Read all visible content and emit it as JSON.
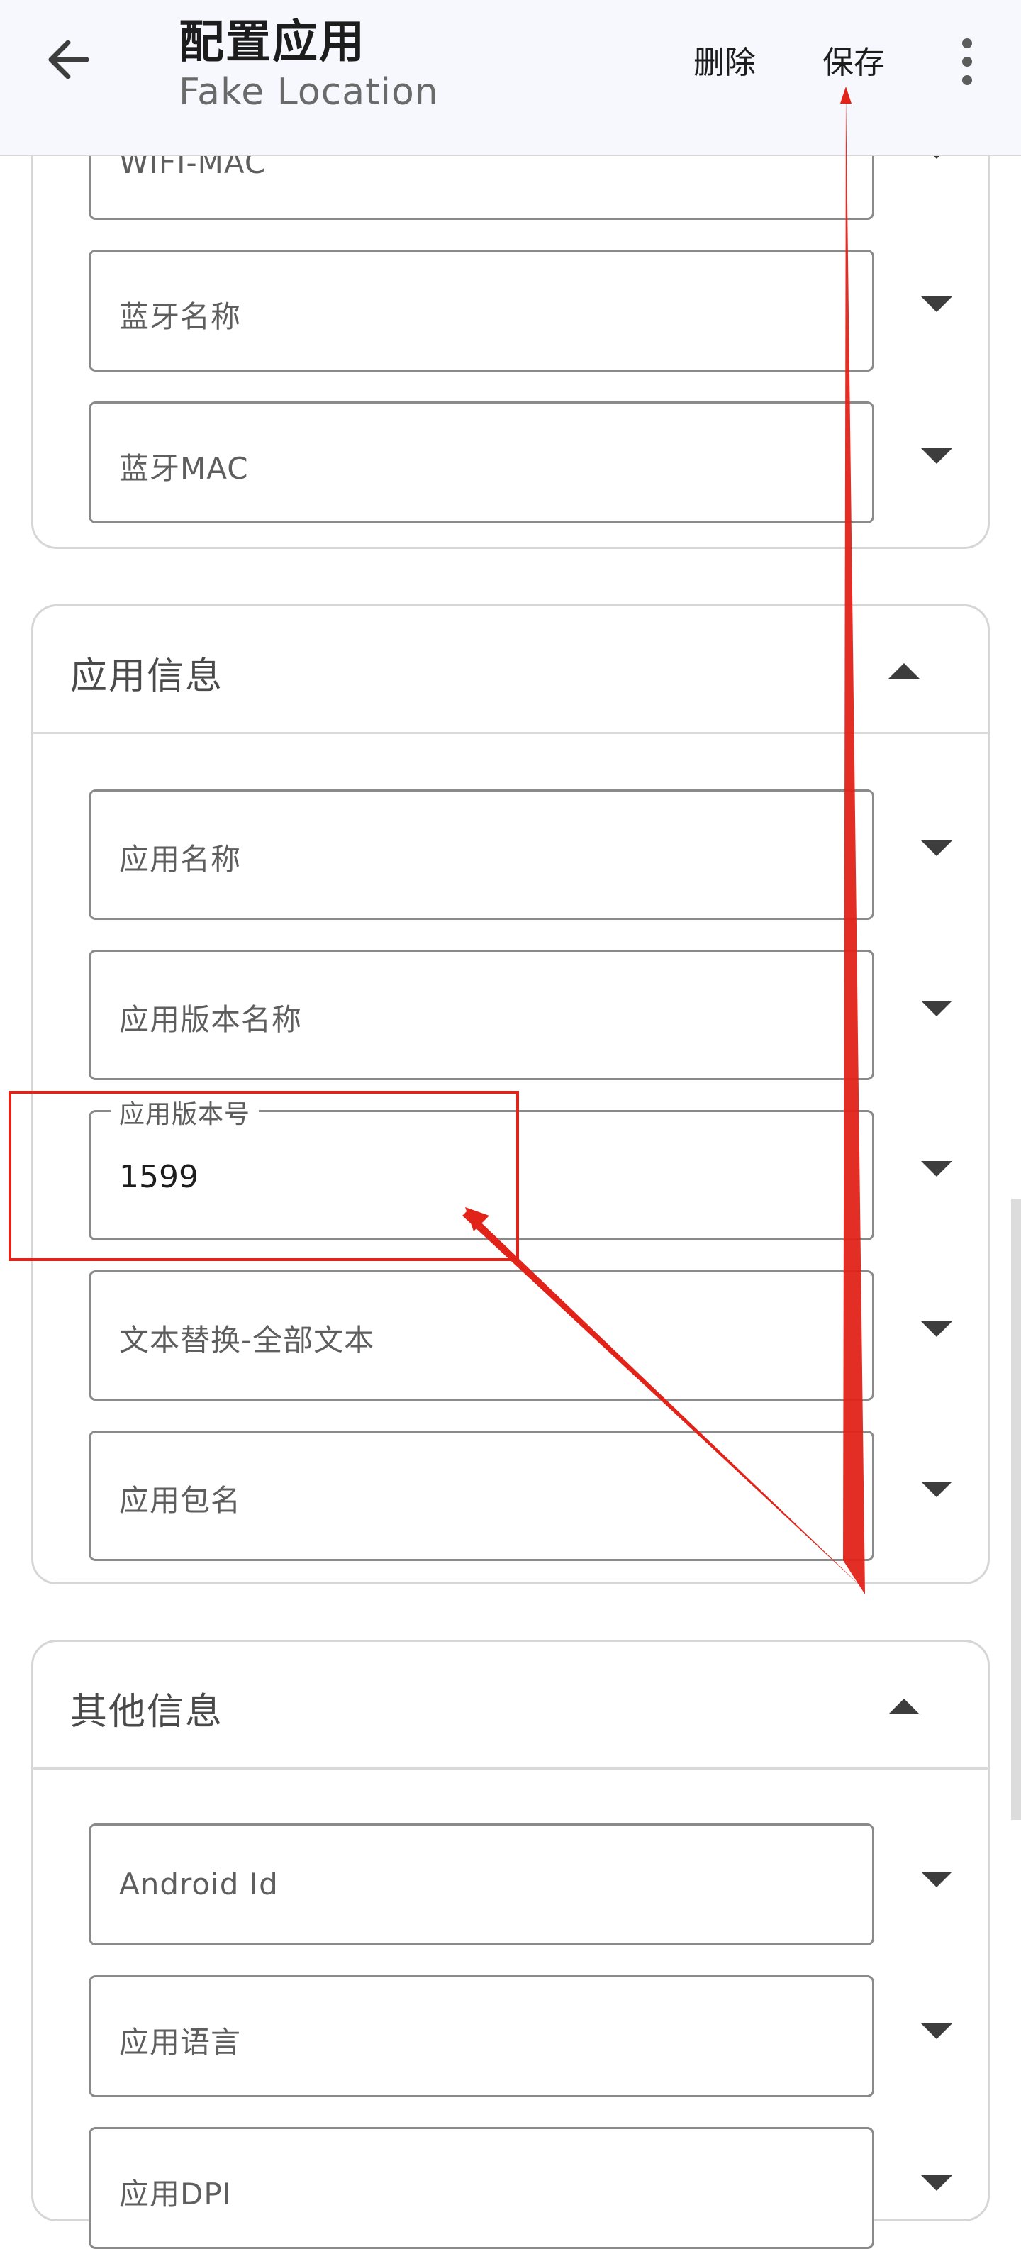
{
  "appbar": {
    "title": "配置应用",
    "subtitle": "Fake Location",
    "back_icon": "arrow-back-icon",
    "delete_label": "删除",
    "save_label": "保存",
    "more_icon": "more-vert-icon"
  },
  "device_section": {
    "fields": [
      {
        "label": "WIFI-MAC"
      },
      {
        "label": "蓝牙名称"
      },
      {
        "label": "蓝牙MAC"
      }
    ]
  },
  "app_info": {
    "title": "应用信息",
    "fields": [
      {
        "label": "应用名称"
      },
      {
        "label": "应用版本名称"
      },
      {
        "label": "应用版本号",
        "value": "1599"
      },
      {
        "label": "文本替换-全部文本"
      },
      {
        "label": "应用包名"
      }
    ]
  },
  "other_info": {
    "title": "其他信息",
    "fields": [
      {
        "label": "Android Id"
      },
      {
        "label": "应用语言"
      },
      {
        "label": "应用DPI"
      }
    ]
  },
  "colors": {
    "appbar_bg": "#f6f8fe",
    "annotation_red": "#e2231a",
    "field_border": "#8a8a8a"
  }
}
